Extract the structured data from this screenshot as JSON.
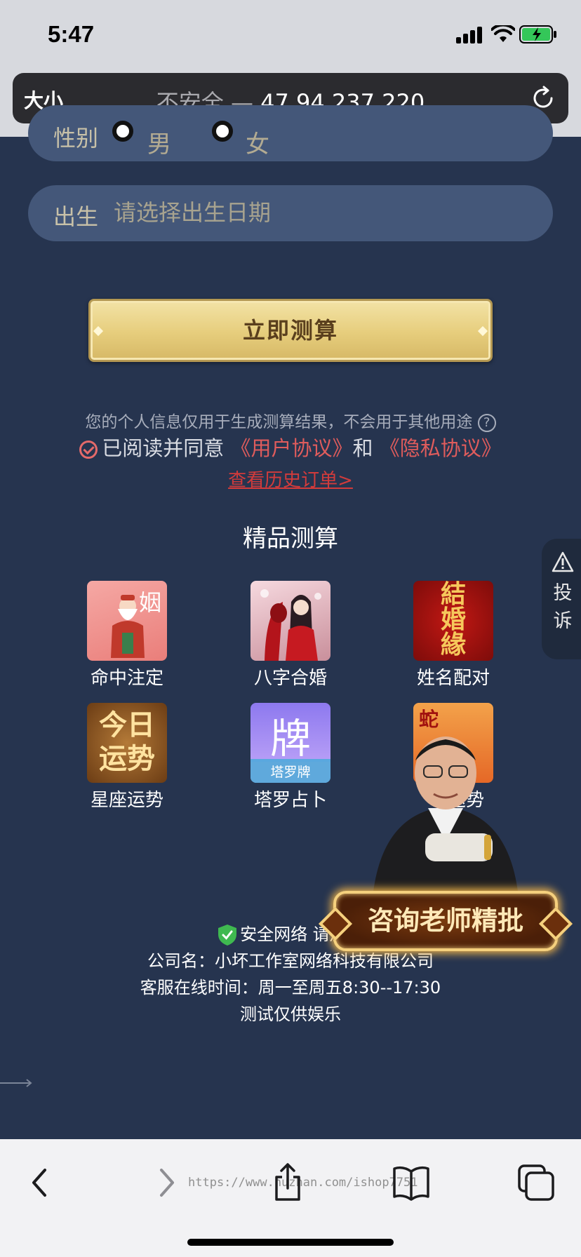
{
  "status_bar": {
    "time": "5:47"
  },
  "address_bar": {
    "text_size_button": "大小",
    "security_label": "不安全 — ",
    "url": "47.94.237.220"
  },
  "form": {
    "gender_label": "性别",
    "gender_options": [
      "男",
      "女"
    ],
    "birth_label": "出生",
    "birth_placeholder": "请选择出生日期"
  },
  "cta_label": "立即测算",
  "notice": "您的个人信息仅用于生成测算结果，不会用于其他用途",
  "agreement": {
    "prefix": "已阅读并同意",
    "user_agreement": "《用户协议》",
    "and": "和",
    "privacy_agreement": "《隐私协议》"
  },
  "history_link": "查看历史订单>",
  "section_title": "精品测算",
  "products": [
    {
      "name": "命中注定",
      "thumb_text": "姻"
    },
    {
      "name": "八字合婚"
    },
    {
      "name": "姓名配对",
      "thumb_text": [
        "結",
        "婚",
        "緣"
      ]
    },
    {
      "name": "星座运势",
      "thumb_text": [
        "今日",
        "运势"
      ]
    },
    {
      "name": "塔罗占卜",
      "thumb_text": "牌",
      "thumb_tag": "塔罗牌"
    },
    {
      "name": "运势",
      "thumb_text": "蛇"
    }
  ],
  "complaint_tab": [
    "投",
    "诉"
  ],
  "consult_banner": "咨询老师精批",
  "footer": {
    "security": "安全网络 请放心",
    "company": "公司名：小坏工作室网络科技有限公司",
    "service_hours": "客服在线时间：周一至周五8:30--17:30",
    "disclaimer": "测试仅供娱乐"
  },
  "toolbar": {
    "watermark": "https://www.huzhan.com/ishop7751"
  }
}
